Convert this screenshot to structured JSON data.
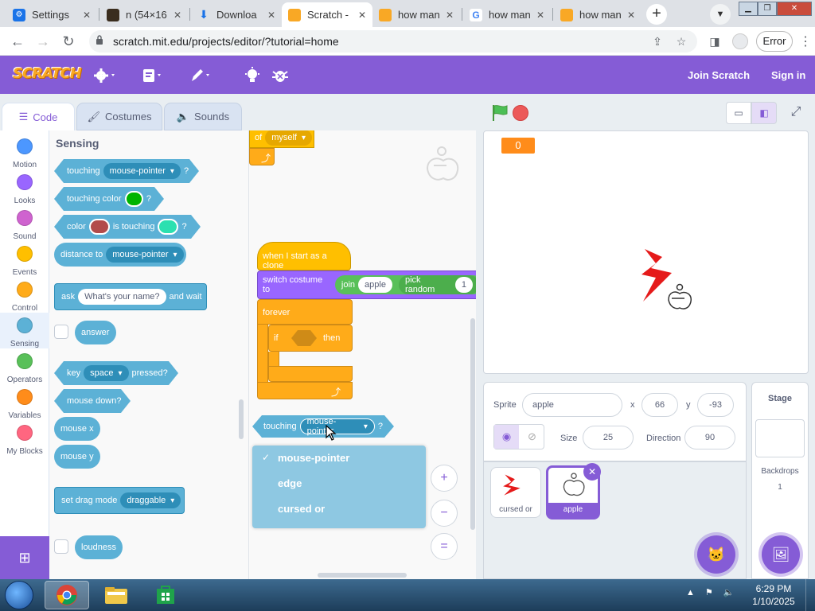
{
  "browser": {
    "tabs": [
      {
        "label": "Settings",
        "icon": "gear-icon",
        "active": false
      },
      {
        "label": "n (54×16",
        "icon": "image-icon",
        "active": false
      },
      {
        "label": "Downloa",
        "icon": "download-icon",
        "active": false
      },
      {
        "label": "Scratch -",
        "icon": "scratch-icon",
        "active": true
      },
      {
        "label": "how man",
        "icon": "scratch-icon",
        "active": false
      },
      {
        "label": "how man",
        "icon": "google-icon",
        "active": false
      },
      {
        "label": "how man",
        "icon": "scratch-icon",
        "active": false
      }
    ],
    "url": "scratch.mit.edu/projects/editor/?tutorial=home",
    "error_label": "Error"
  },
  "menubar": {
    "logo": "SCRATCH",
    "join": "Join Scratch",
    "signin": "Sign in"
  },
  "editor_tabs": {
    "code": "Code",
    "costumes": "Costumes",
    "sounds": "Sounds"
  },
  "categories": [
    {
      "label": "Motion",
      "color": "#4c97ff"
    },
    {
      "label": "Looks",
      "color": "#9966ff"
    },
    {
      "label": "Sound",
      "color": "#cf63cf"
    },
    {
      "label": "Events",
      "color": "#ffbf00"
    },
    {
      "label": "Control",
      "color": "#ffab19"
    },
    {
      "label": "Sensing",
      "color": "#5cb1d6"
    },
    {
      "label": "Operators",
      "color": "#59c059"
    },
    {
      "label": "Variables",
      "color": "#ff8c1a"
    },
    {
      "label": "My Blocks",
      "color": "#ff6680"
    }
  ],
  "palette": {
    "title": "Sensing",
    "touching": "touching",
    "touching_target": "mouse-pointer",
    "q": "?",
    "touching_color": "touching color",
    "color": "color",
    "is_touching": "is touching",
    "distance_to": "distance to",
    "distance_target": "mouse-pointer",
    "ask": "ask",
    "ask_default": "What's your name?",
    "and_wait": "and wait",
    "answer": "answer",
    "key": "key",
    "key_value": "space",
    "pressed": "pressed?",
    "mouse_down": "mouse down?",
    "mouse_x": "mouse x",
    "mouse_y": "mouse y",
    "set_drag_mode": "set drag mode",
    "drag_value": "draggable",
    "loudness": "loudness",
    "swatch_green": "#00b400",
    "swatch_red": "#b24b4b",
    "swatch_teal": "#2be0b0"
  },
  "script": {
    "top_partial_of": "of",
    "top_partial_value": "myself",
    "hat_clone": "when I start as a clone",
    "switch_costume": "switch costume to",
    "join": "join",
    "join_value": "apple",
    "pick_random": "pick random",
    "pick_value": "1",
    "forever": "forever",
    "if": "if",
    "then": "then",
    "drag_touching": "touching",
    "drag_target": "mouse-pointer",
    "drag_q": "?",
    "dropdown_options": [
      "mouse-pointer",
      "edge",
      "cursed or"
    ],
    "zoom_in": "+",
    "zoom_out": "−",
    "zoom_reset": "="
  },
  "stage": {
    "score": "0"
  },
  "sprite_info": {
    "sprite_label": "Sprite",
    "sprite_name": "apple",
    "x_label": "x",
    "x_value": "66",
    "y_label": "y",
    "y_value": "-93",
    "size_label": "Size",
    "size_value": "25",
    "direction_label": "Direction",
    "direction_value": "90"
  },
  "sprites": [
    {
      "name": "cursed or",
      "selected": false
    },
    {
      "name": "apple",
      "selected": true
    }
  ],
  "stage_panel": {
    "title": "Stage",
    "backdrops_label": "Backdrops",
    "backdrops_count": "1"
  },
  "taskbar": {
    "time": "6:29 PM",
    "date": "1/10/2025"
  }
}
